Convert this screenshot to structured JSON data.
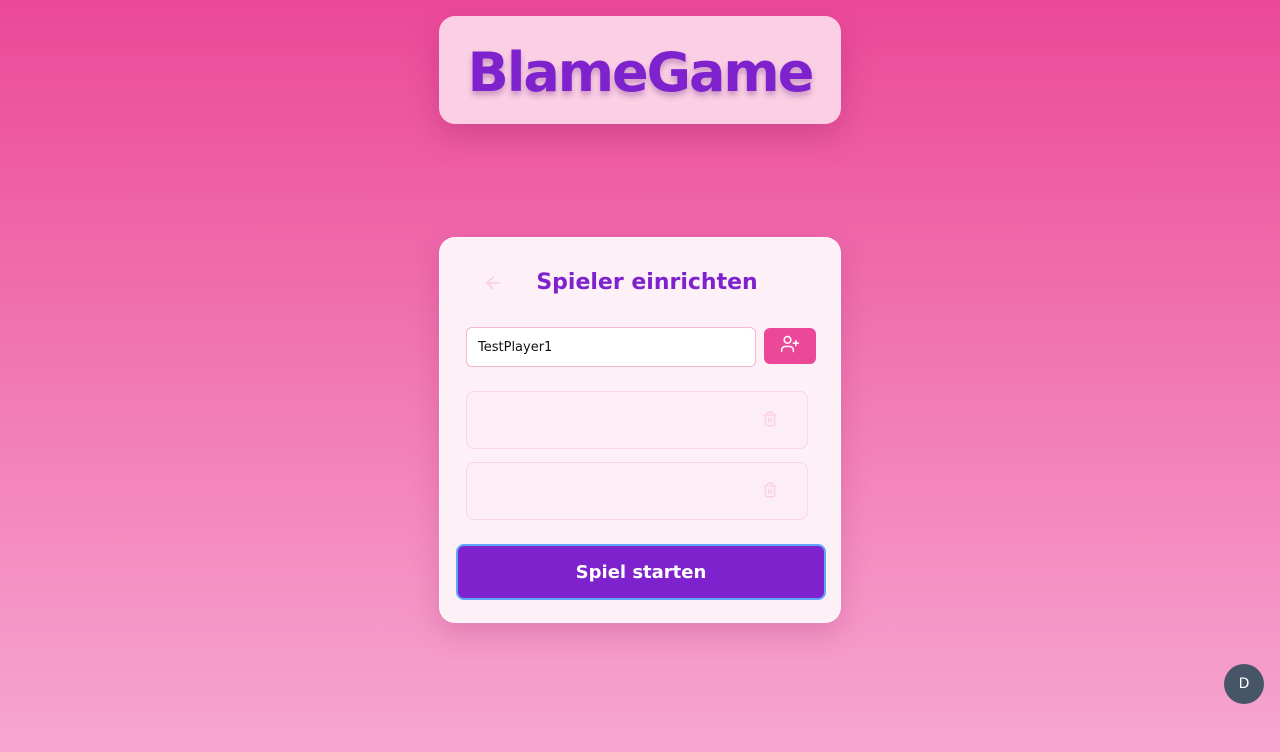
{
  "app": {
    "logo_text": "BlameGame"
  },
  "setup": {
    "title": "Spieler einrichten",
    "back_icon": "arrow-left-icon",
    "name_input": {
      "value": "TestPlayer1",
      "placeholder": ""
    },
    "add_icon": "user-plus-icon",
    "players": [
      {
        "name": "",
        "delete_icon": "trash-icon"
      },
      {
        "name": "",
        "delete_icon": "trash-icon"
      }
    ],
    "start_label": "Spiel starten"
  },
  "user": {
    "avatar_initial": "D"
  },
  "colors": {
    "brand_purple": "#7e22ce",
    "brand_pink": "#ec4899",
    "card_bg": "#fdf0f6",
    "avatar_bg": "#475569",
    "focus_ring": "#60a5fa"
  }
}
